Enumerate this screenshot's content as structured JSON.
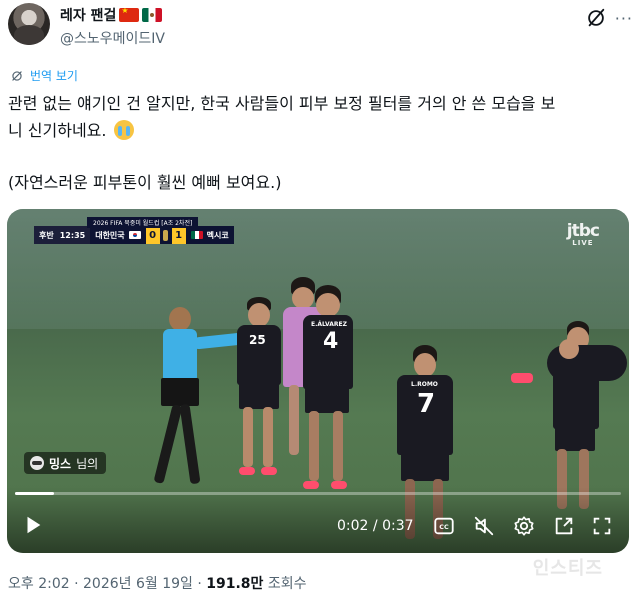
{
  "author": {
    "display_name": "레자 팬걸",
    "handle": "@스노우메이드IV",
    "flags": [
      "china-flag",
      "mexico-flag"
    ]
  },
  "header_actions": {
    "grok_icon": "slashed-circle-icon",
    "more_icon": "more-icon"
  },
  "translate_label": "번역 보기",
  "tweet": {
    "line1": "관련 없는 얘기인 건 알지만, 한국 사람들이 피부 보정 필터를 거의 안 쓴 모습을 보",
    "line2": "니 신기하네요.",
    "line3": "(자연스러운 피부톤이 훨씬 예뻐 보여요.)"
  },
  "video": {
    "scoreboard": {
      "half": "후반",
      "clock": "12:35",
      "home_team": "대한민국",
      "home_score": "0",
      "away_score": "1",
      "away_team": "멕시코",
      "competition": "2026 FIFA 북중미 월드컵 [A조 2차전]"
    },
    "broadcaster": "jtbc",
    "live_label": "LIVE",
    "jersey_numbers": [
      "25",
      "4",
      "7"
    ],
    "jersey_names": [
      "E.ÁLVAREZ",
      "L.ROMO"
    ],
    "mention_name": "밍스",
    "mention_suffix": "님의",
    "progress_fraction": 0.065,
    "time_current": "0:02",
    "time_total": "0:37",
    "cc_label": "CC"
  },
  "footer": {
    "time_date": "오후 2:02 · 2026년 6월 19일 · ",
    "views": "191.8만",
    "views_label": " 조회수"
  },
  "watermark": "인스티즈",
  "colors": {
    "link": "#1d9bf0",
    "text": "#0f1419",
    "muted": "#536471"
  }
}
